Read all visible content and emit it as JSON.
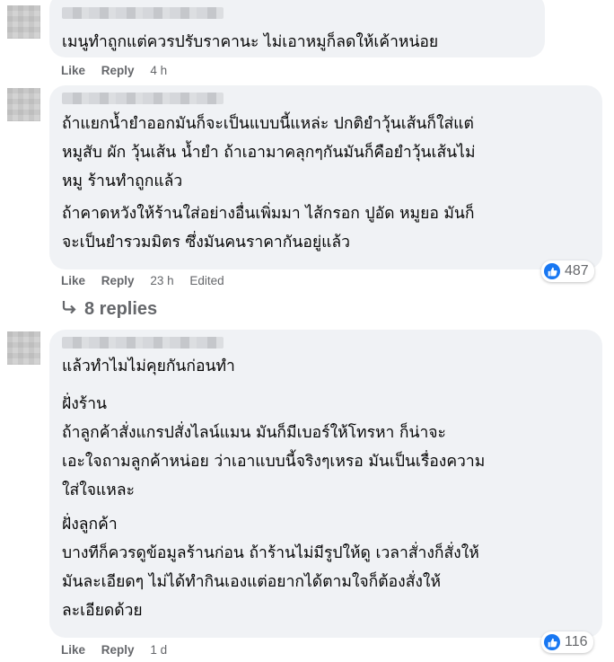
{
  "comments": [
    {
      "paragraphs": [
        "เมนูทำถูกแต่ควรปรับราคานะ ไม่เอาหมูก็ลดให้เค้าหน่อย"
      ],
      "like_label": "Like",
      "reply_label": "Reply",
      "time": "4 h"
    },
    {
      "paragraphs": [
        "ถ้าแยกน้ำยำออกมันก็จะเป็นแบบนี้แหล่ะ ปกติยำวุ้นเส้นก็ใส่แต่\nหมูสับ ผัก วุ้นเส้น น้ำยำ ถ้าเอามาคลุกๆกันมันก็คือยำวุ้นเส้นไม่\nหมู ร้านทำถูกแล้ว",
        "ถ้าคาดหวังให้ร้านใส่อย่างอื่นเพิ่มมา ไส้กรอก ปูอัด หมูยอ มันก็\nจะเป็นยำรวมมิตร ซึ่งมันคนราคากันอยู่แล้ว"
      ],
      "like_label": "Like",
      "reply_label": "Reply",
      "time": "23 h",
      "edited": "Edited",
      "reactions": "487",
      "replies": "8 replies"
    },
    {
      "paragraphs": [
        "แล้วทำไมไม่คุยกันก่อนทำ",
        "ฝั่งร้าน\nถ้าลูกค้าสั่งแกรปสั่งไลน์แมน มันก็มีเบอร์ให้โทรหา ก็น่าจะ\nเอะใจถามลูกค้าหน่อย ว่าเอาแบบนี้จริงๆเหรอ มันเป็นเรื่องความ\nใส่ใจแหละ",
        "ฝั่งลูกค้า\nบางทีก็ควรดูข้อมูลร้านก่อน ถ้าร้านไม่มีรูปให้ดู เวลาสั่างก็สั่งให้\nมันละเอียดๆ ไม่ได้ทำกินเองแต่อยากได้ตามใจก็ต้องสั่งให้\nละเอียดด้วย"
      ],
      "like_label": "Like",
      "reply_label": "Reply",
      "time": "1 d",
      "reactions": "116"
    }
  ],
  "colors": {
    "bubble": "#f0f2f5",
    "meta": "#65676b",
    "like_blue": "#1877f2"
  },
  "icons": {
    "reaction": "like-icon",
    "replies": "reply-arrow-icon"
  }
}
